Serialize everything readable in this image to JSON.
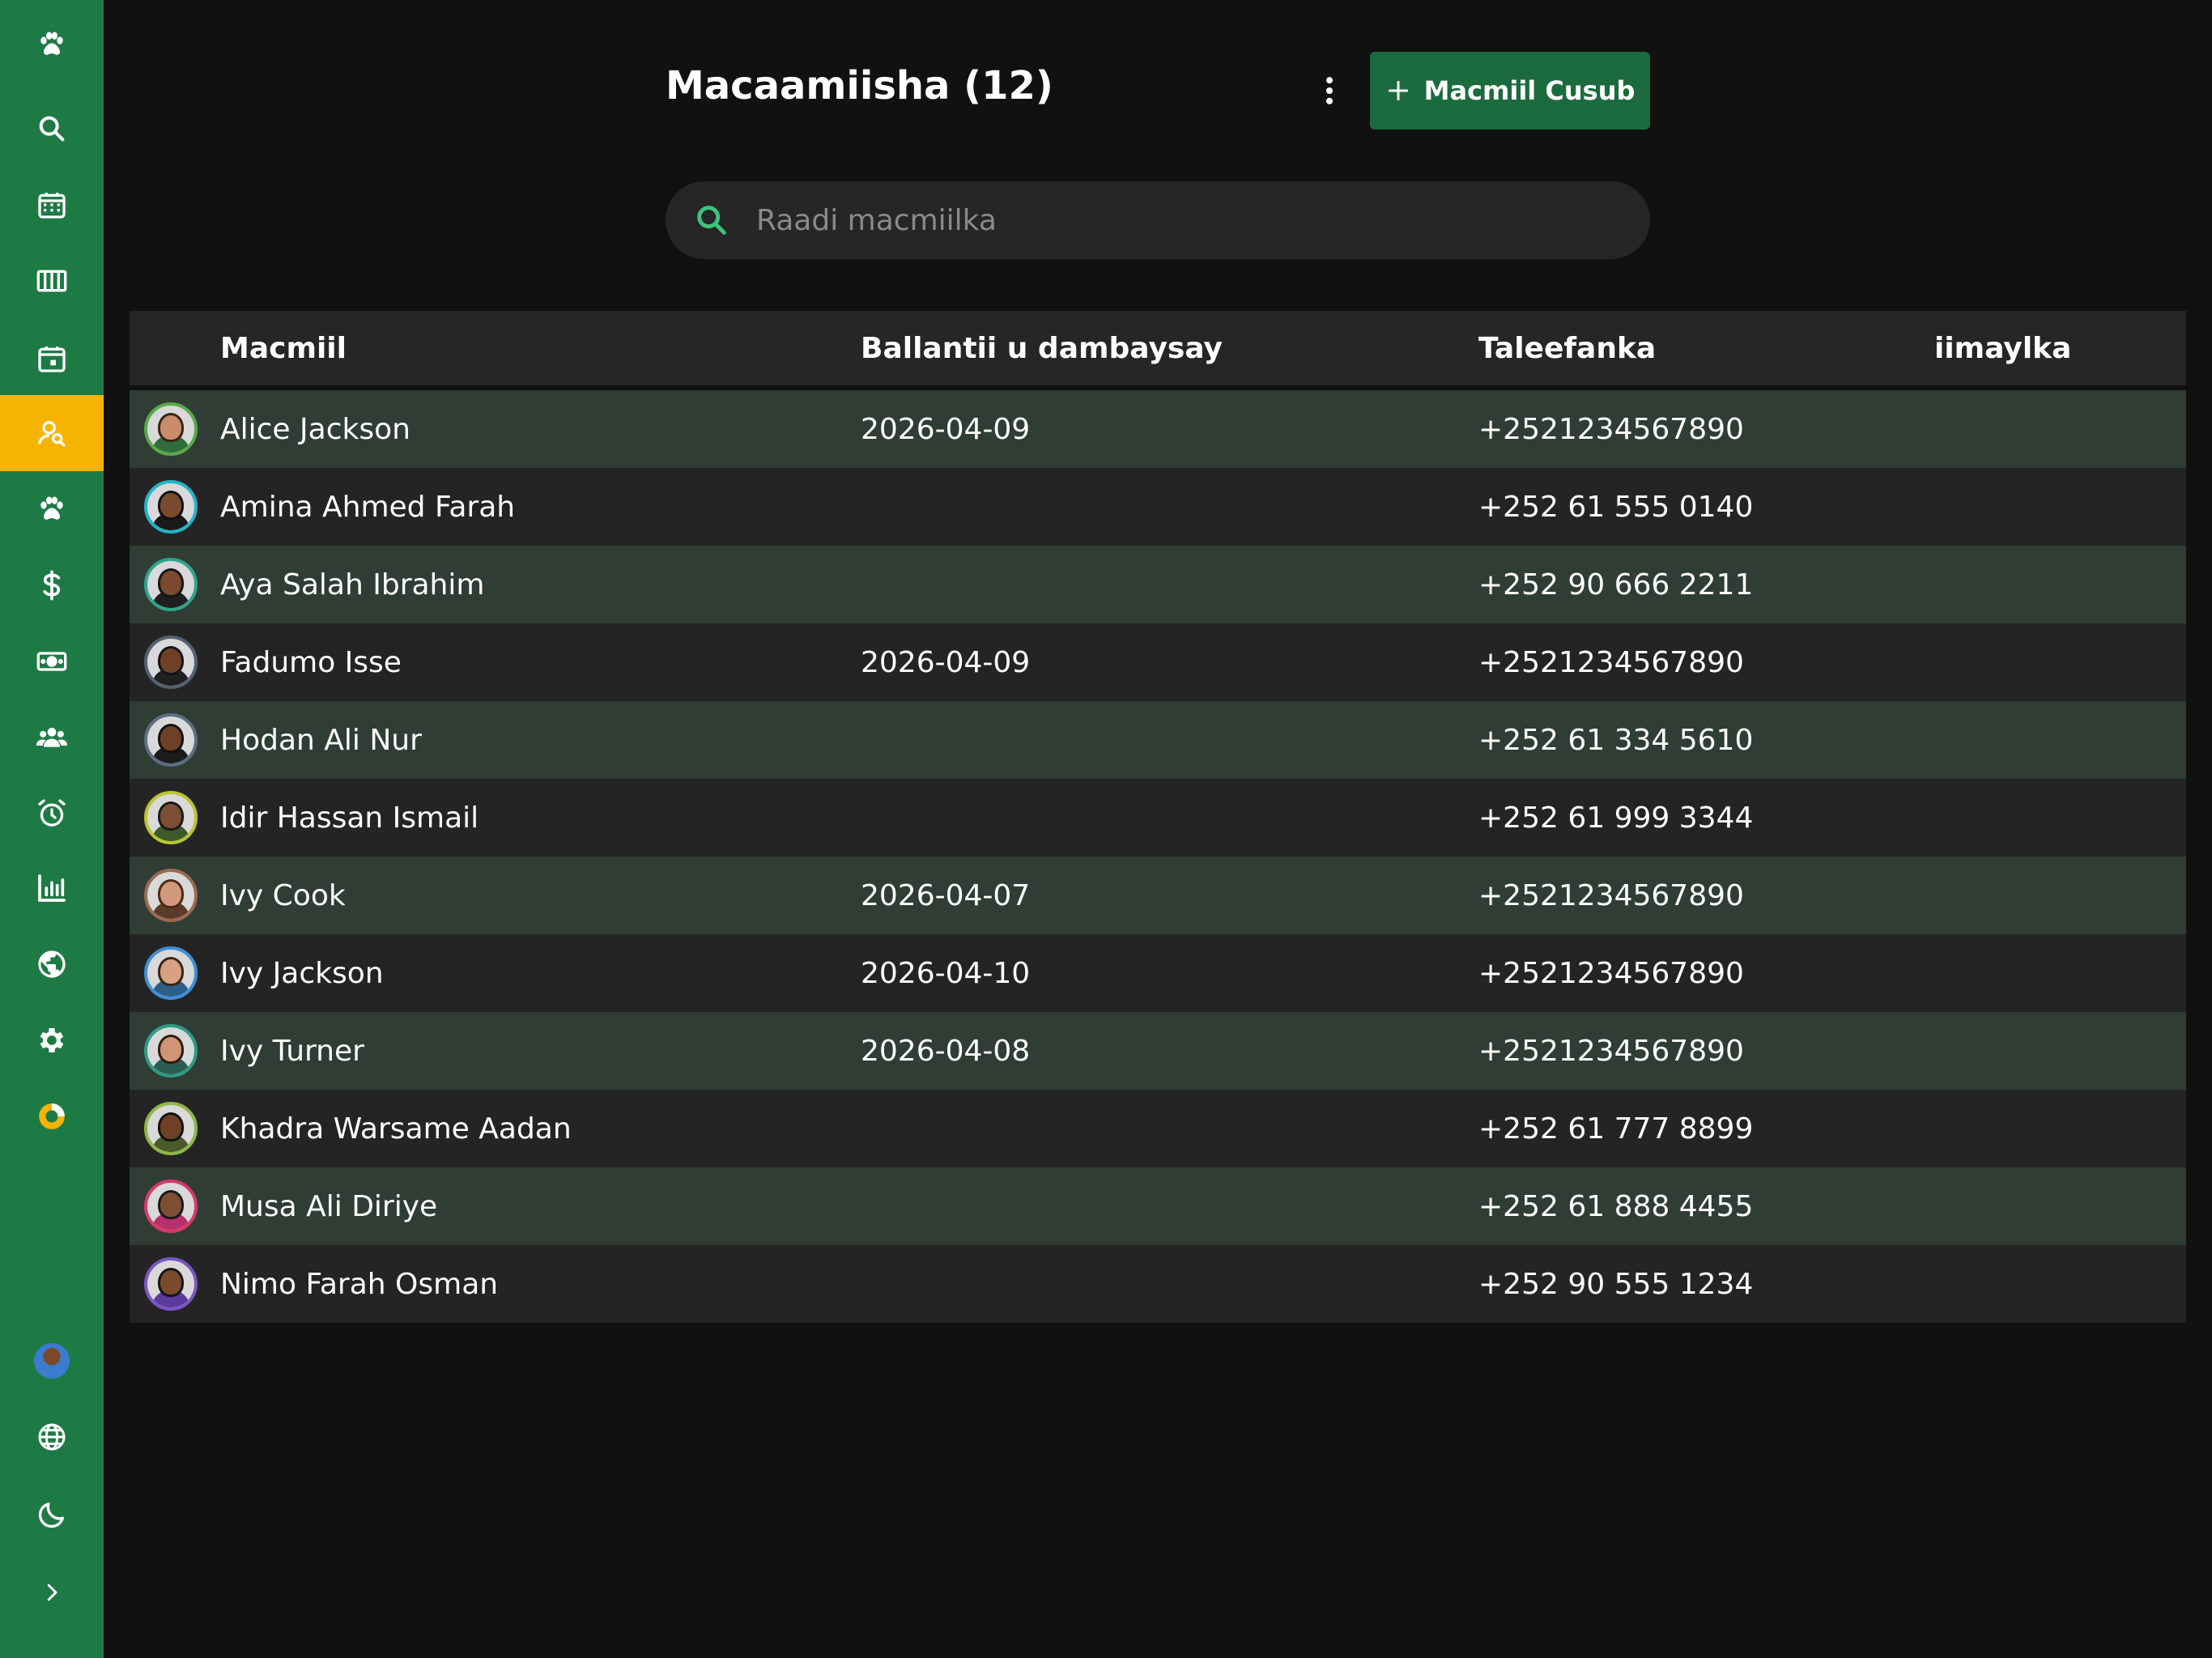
{
  "colors": {
    "sidebar": "#1e7a45",
    "sidebar_active": "#f6b400",
    "primary_button": "#1c6b3e",
    "background": "#111111",
    "row_alt": "#2f3d35",
    "row": "#242424",
    "search_icon": "#3cc47c"
  },
  "sidebar": {
    "items": [
      {
        "icon": "paw-logo-icon",
        "active": false
      },
      {
        "icon": "search-icon",
        "active": false
      },
      {
        "icon": "calendar-grid-icon",
        "active": false
      },
      {
        "icon": "columns-icon",
        "active": false
      },
      {
        "icon": "calendar-event-icon",
        "active": false
      },
      {
        "icon": "client-search-icon",
        "active": true
      },
      {
        "icon": "paw-icon",
        "active": false
      },
      {
        "icon": "dollar-icon",
        "active": false
      },
      {
        "icon": "banknote-icon",
        "active": false
      },
      {
        "icon": "team-icon",
        "active": false
      },
      {
        "icon": "alarm-icon",
        "active": false
      },
      {
        "icon": "bar-chart-icon",
        "active": false
      },
      {
        "icon": "globe-icon",
        "active": false
      },
      {
        "icon": "gear-icon",
        "active": false
      },
      {
        "icon": "donut-icon",
        "active": false
      }
    ],
    "bottom": [
      {
        "icon": "user-avatar"
      },
      {
        "icon": "language-globe-icon"
      },
      {
        "icon": "moon-icon"
      },
      {
        "icon": "chevron-right-icon"
      }
    ]
  },
  "header": {
    "title": "Macaamiisha (12)",
    "add_button": "Macmiil Cusub"
  },
  "search": {
    "placeholder": "Raadi macmiilka",
    "value": ""
  },
  "table": {
    "columns": [
      "Macmiil",
      "Ballantii u dambaysay",
      "Taleefanka",
      "iimaylka"
    ],
    "rows": [
      {
        "name": "Alice Jackson",
        "last_appointment": "2026-04-09",
        "phone": "+2521234567890",
        "email": "",
        "ring": "#5aa84a",
        "skin": "#c98d6b",
        "hair": "#3a2416",
        "shirt": "#2e6e3a"
      },
      {
        "name": "Amina Ahmed Farah",
        "last_appointment": "",
        "phone": "+252 61 555 0140",
        "email": "",
        "ring": "#21b5c6",
        "skin": "#7a4a2e",
        "hair": "#111111",
        "shirt": "#1a1a1a"
      },
      {
        "name": "Aya Salah Ibrahim",
        "last_appointment": "",
        "phone": "+252 90 666 2211",
        "email": "",
        "ring": "#2fa48b",
        "skin": "#7a4a2e",
        "hair": "#161616",
        "shirt": "#1f1f1f"
      },
      {
        "name": "Fadumo Isse",
        "last_appointment": "2026-04-09",
        "phone": "+2521234567890",
        "email": "",
        "ring": "#556070",
        "skin": "#6e4127",
        "hair": "#141414",
        "shirt": "#202020"
      },
      {
        "name": "Hodan Ali Nur",
        "last_appointment": "",
        "phone": "+252 61 334 5610",
        "email": "",
        "ring": "#5d6e80",
        "skin": "#6e4127",
        "hair": "#121212",
        "shirt": "#1c1c1c"
      },
      {
        "name": "Idir Hassan Ismail",
        "last_appointment": "",
        "phone": "+252 61 999 3344",
        "email": "",
        "ring": "#b9c531",
        "skin": "#7c4f32",
        "hair": "#1a1a1a",
        "shirt": "#3d5a2a"
      },
      {
        "name": "Ivy Cook",
        "last_appointment": "2026-04-07",
        "phone": "+2521234567890",
        "email": "",
        "ring": "#9a6a52",
        "skin": "#d29a7c",
        "hair": "#4a2a18",
        "shirt": "#5c3a2a"
      },
      {
        "name": "Ivy Jackson",
        "last_appointment": "2026-04-10",
        "phone": "+2521234567890",
        "email": "",
        "ring": "#3e8fd6",
        "skin": "#d7a183",
        "hair": "#3a2416",
        "shirt": "#2c5e8a"
      },
      {
        "name": "Ivy Turner",
        "last_appointment": "2026-04-08",
        "phone": "+2521234567890",
        "email": "",
        "ring": "#2e9a86",
        "skin": "#cf9577",
        "hair": "#2e1c10",
        "shirt": "#2b5d52"
      },
      {
        "name": "Khadra Warsame Aadan",
        "last_appointment": "",
        "phone": "+252 61 777 8899",
        "email": "",
        "ring": "#8fb64a",
        "skin": "#6e4127",
        "hair": "#121212",
        "shirt": "#4a5a2a"
      },
      {
        "name": "Musa Ali Diriye",
        "last_appointment": "",
        "phone": "+252 61 888 4455",
        "email": "",
        "ring": "#d63a6a",
        "skin": "#7c4f32",
        "hair": "#1a1a1a",
        "shirt": "#b8306a"
      },
      {
        "name": "Nimo Farah Osman",
        "last_appointment": "",
        "phone": "+252 90 555 1234",
        "email": "",
        "ring": "#7a55c2",
        "skin": "#7a4a2e",
        "hair": "#151515",
        "shirt": "#5a3a9a"
      }
    ]
  }
}
